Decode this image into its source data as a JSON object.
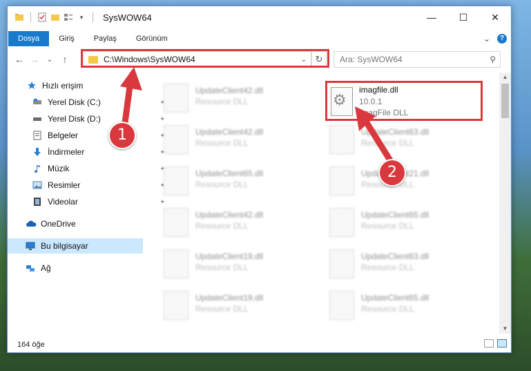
{
  "window": {
    "title": "SysWOW64",
    "controls": {
      "minimize": "—",
      "maximize": "☐",
      "close": "✕"
    }
  },
  "ribbon": {
    "tabs": [
      "Dosya",
      "Giriş",
      "Paylaş",
      "Görünüm"
    ],
    "expand_glyph": "⌄",
    "help_glyph": "?"
  },
  "nav": {
    "back": "←",
    "forward": "→",
    "recent": "⌄",
    "up": "↑",
    "address": "C:\\Windows\\SysWOW64",
    "address_chevron": "⌄",
    "refresh": "↻",
    "search_placeholder": "Ara: SysWOW64",
    "search_icon": "⚲"
  },
  "sidebar": {
    "items": [
      {
        "label": "Hızlı erişim",
        "icon": "star-icon"
      },
      {
        "label": "Yerel Disk (C:)",
        "icon": "drive-icon",
        "pinned": true
      },
      {
        "label": "Yerel Disk (D:)",
        "icon": "drive-icon",
        "pinned": true
      },
      {
        "label": "Belgeler",
        "icon": "documents-icon",
        "pinned": true
      },
      {
        "label": "İndirmeler",
        "icon": "download-icon",
        "pinned": true
      },
      {
        "label": "Müzik",
        "icon": "music-icon",
        "pinned": true
      },
      {
        "label": "Resimler",
        "icon": "pictures-icon",
        "pinned": true
      },
      {
        "label": "Videolar",
        "icon": "videos-icon",
        "pinned": true
      },
      {
        "label": "OneDrive",
        "icon": "onedrive-icon"
      },
      {
        "label": "Bu bilgisayar",
        "icon": "computer-icon",
        "selected": true
      },
      {
        "label": "Ağ",
        "icon": "network-icon"
      }
    ],
    "pin_glyph": "📌"
  },
  "files": {
    "left_column": [
      {
        "name": "UpdateClient42.dll",
        "type": "Resource DLL"
      },
      {
        "name": "UpdateClient42.dll",
        "type": "Resource DLL"
      },
      {
        "name": "UpdateClient65.dll",
        "type": "Resource DLL"
      },
      {
        "name": "UpdateClient42.dll",
        "type": "Resource DLL"
      },
      {
        "name": "UpdateClient19.dll",
        "type": "Resource DLL"
      },
      {
        "name": "UpdateClient19.dll",
        "type": "Resource DLL"
      }
    ],
    "right_column": [
      {
        "name": "UpdateClient63.dll",
        "type": "Resource DLL"
      },
      {
        "name": "UpdateClient21.dll",
        "type": "Resource DLL"
      },
      {
        "name": "UpdateClient65.dll",
        "type": "Resource DLL"
      },
      {
        "name": "UpdateClient63.dll",
        "type": "Resource DLL"
      },
      {
        "name": "UpdateClient65.dll",
        "type": "Resource DLL"
      }
    ],
    "highlighted": {
      "name": "imagfile.dll",
      "version": "10.0.1",
      "description": "ImagFile DLL"
    }
  },
  "status": {
    "item_count": "164 öğe"
  },
  "annotations": {
    "step1": "1",
    "step2": "2",
    "color": "#d9383e"
  }
}
